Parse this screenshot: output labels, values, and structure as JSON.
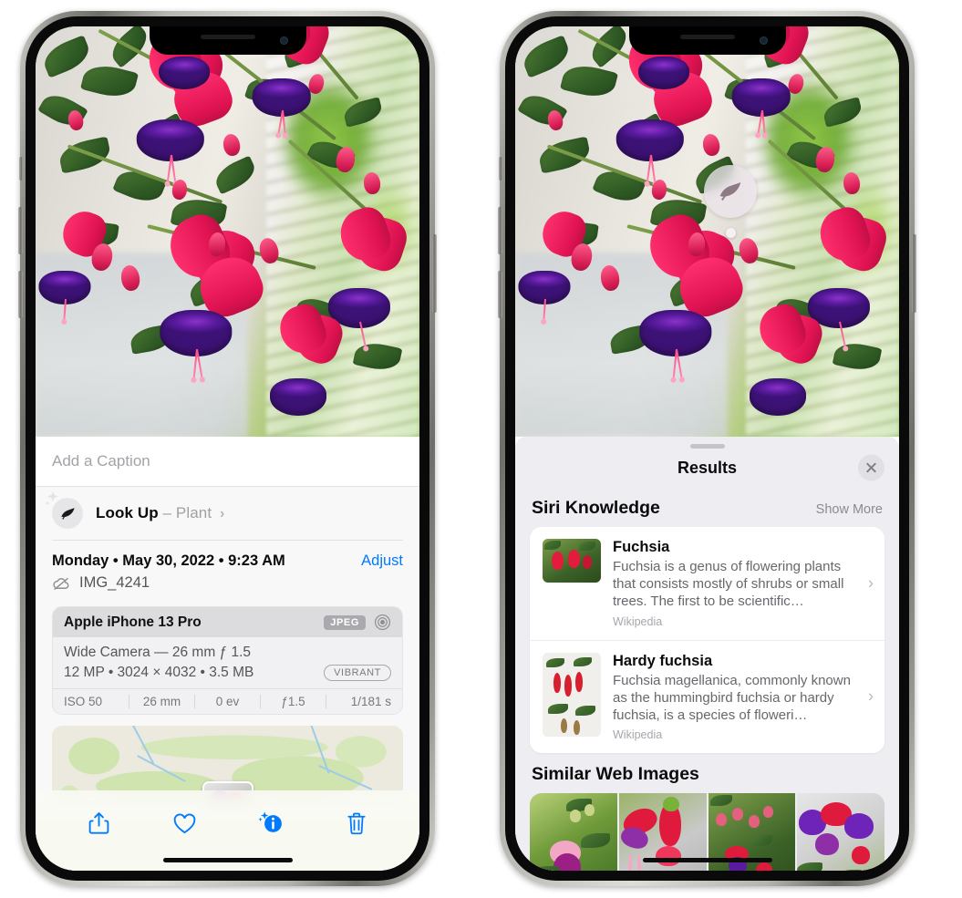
{
  "left_phone": {
    "photo": {
      "alt": "fuchsia-flowers-photo"
    },
    "caption": {
      "placeholder": "Add a Caption",
      "value": ""
    },
    "look_up": {
      "icon": "leaf-icon",
      "sparkle_icon": "sparkle-icon",
      "label": "Look Up",
      "dash": "–",
      "subject": "Plant",
      "chevron": "›"
    },
    "metadata": {
      "date_line": "Monday • May 30, 2022 • 9:23 AM",
      "adjust_label": "Adjust",
      "cloud_icon": "icloud-slash-icon",
      "filename": "IMG_4241"
    },
    "exif": {
      "device": "Apple iPhone 13 Pro",
      "format_badge": "JPEG",
      "aperture_icon": "aperture-icon",
      "lens_line": "Wide Camera — 26 mm ƒ 1.5",
      "size_line": "12 MP • 3024 × 4032 • 3.5 MB",
      "style_badge": "VIBRANT",
      "stats": [
        "ISO 50",
        "26 mm",
        "0 ev",
        "ƒ1.5",
        "1/181 s"
      ]
    },
    "map": {
      "name": "location-map",
      "pin": "photo-thumbnail-pin"
    },
    "toolbar": [
      {
        "name": "share-button",
        "icon": "share-icon"
      },
      {
        "name": "favorite-button",
        "icon": "heart-icon"
      },
      {
        "name": "info-button",
        "icon": "info-sparkle-icon"
      },
      {
        "name": "delete-button",
        "icon": "trash-icon"
      }
    ]
  },
  "right_phone": {
    "visual_lookup_badge": {
      "icon": "leaf-icon",
      "name": "visual-look-up-badge"
    },
    "sheet": {
      "title": "Results",
      "close_icon": "close-icon",
      "siri_knowledge": {
        "title": "Siri Knowledge",
        "show_more": "Show More",
        "items": [
          {
            "name": "Fuchsia",
            "description": "Fuchsia is a genus of flowering plants that consists mostly of shrubs or small trees. The first to be scientific…",
            "source": "Wikipedia",
            "chevron": "›"
          },
          {
            "name": "Hardy fuchsia",
            "description": "Fuchsia magellanica, commonly known as the hummingbird fuchsia or hardy fuchsia, is a species of floweri…",
            "source": "Wikipedia",
            "chevron": "›"
          }
        ]
      },
      "similar_web_images": {
        "title": "Similar Web Images",
        "thumbnails": [
          "web-image-1",
          "web-image-2",
          "web-image-3",
          "web-image-4"
        ]
      }
    }
  },
  "colors": {
    "accent_blue": "#007aff",
    "sheet_background": "#eeeef2",
    "card_white": "#ffffff",
    "page_background": "#f8f8f8",
    "exif_header": "#dcdcde",
    "secondary_text": "#67676d"
  }
}
